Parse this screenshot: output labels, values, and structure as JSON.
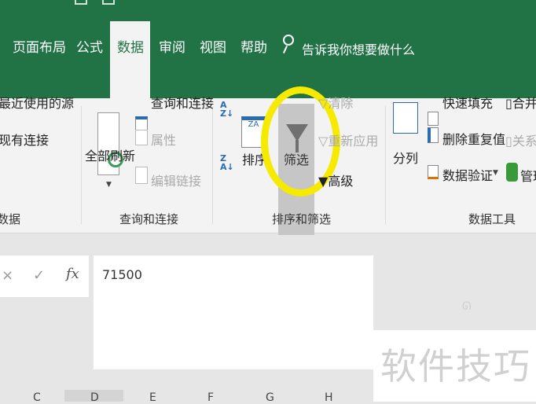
{
  "tabs": [
    "页面布局",
    "公式",
    "数据",
    "审阅",
    "视图",
    "帮助"
  ],
  "active_tab": "数据",
  "search_placeholder": "告诉我你想要做什么",
  "ribbon": {
    "get_data": {
      "recent_sources": "最近使用的源",
      "existing_connections": "现有连接",
      "group_label": "数据"
    },
    "queries": {
      "refresh_all": "全部刷新",
      "queries_connections": "查询和连接",
      "properties": "属性",
      "edit_links": "编辑链接",
      "group_label": "查询和连接"
    },
    "sort_filter": {
      "sort": "排序",
      "filter": "筛选",
      "clear": "清除",
      "reapply": "重新应用",
      "advanced": "高级",
      "group_label": "排序和筛选"
    },
    "data_tools": {
      "text_to_columns": "分列",
      "flash_fill": "快速填充",
      "remove_duplicates": "删除重复值",
      "data_validation": "数据验证",
      "consolidate": "合并",
      "relationships": "关系",
      "manage": "管理",
      "group_label": "数据工具"
    }
  },
  "formula_bar": {
    "cancel": "×",
    "enter": "✓",
    "fx": "fx",
    "value": "71500"
  },
  "columns": [
    "C",
    "D",
    "E",
    "F",
    "G",
    "H"
  ],
  "watermark": "软件技巧",
  "colors": {
    "brand": "#217346",
    "highlight": "#f5ea00"
  }
}
